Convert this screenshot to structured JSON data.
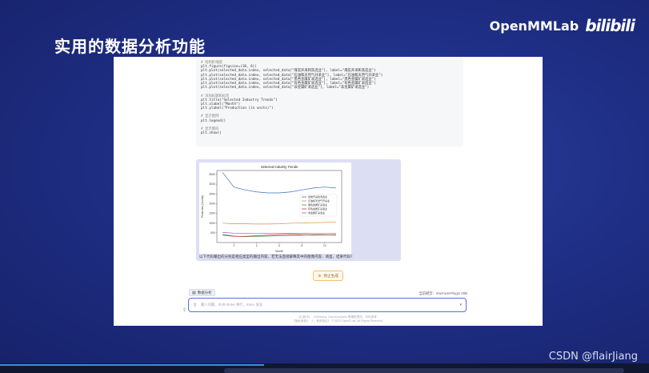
{
  "slide": {
    "title": "实用的数据分析功能",
    "brand": "OpenMMLab",
    "brand_logo_text": "bilibili",
    "watermark": "CSDN @flairJiang"
  },
  "code": {
    "lines": [
      {
        "kind": "comment",
        "text": "# 绘制折线图"
      },
      {
        "kind": "code",
        "text": "plt.figure(figsize=(10, 6))"
      },
      {
        "kind": "code",
        "text": "plt.plot(selected_data.index, selected_data[\"煤炭开采和洗选业\"], label=\"煤炭开采和洗选业\")"
      },
      {
        "kind": "code",
        "text": "plt.plot(selected_data.index, selected_data[\"石油和天然气开采业\"], label=\"石油和天然气开采业\")"
      },
      {
        "kind": "code",
        "text": "plt.plot(selected_data.index, selected_data[\"黑色金属矿采选业\"], label=\"黑色金属矿采选业\")"
      },
      {
        "kind": "code",
        "text": "plt.plot(selected_data.index, selected_data[\"有色金属矿采选业\"], label=\"有色金属矿采选业\")"
      },
      {
        "kind": "code",
        "text": "plt.plot(selected_data.index, selected_data[\"非金属矿采选业\"], label=\"非金属矿采选业\")"
      },
      {
        "kind": "gap",
        "text": ""
      },
      {
        "kind": "comment",
        "text": "# 添加标题和标签"
      },
      {
        "kind": "code",
        "text": "plt.title(\"Selected Industry Trends\")"
      },
      {
        "kind": "code",
        "text": "plt.xlabel(\"Month\")"
      },
      {
        "kind": "code",
        "text": "plt.ylabel(\"Production (in units)\")"
      },
      {
        "kind": "gap",
        "text": ""
      },
      {
        "kind": "comment",
        "text": "# 显示图例"
      },
      {
        "kind": "code",
        "text": "plt.legend()"
      },
      {
        "kind": "gap",
        "text": ""
      },
      {
        "kind": "comment",
        "text": "# 显示图形"
      },
      {
        "kind": "code",
        "text": "plt.show()"
      }
    ]
  },
  "result": {
    "caption": "以下代码输出的分别是相应类型的输出内容，若无法直接解释其中的图像内容，请直，结果代码?"
  },
  "stop_button": {
    "label": "停止生成",
    "icon": "stop-icon"
  },
  "toolbar": {
    "tag_label": "数据分析",
    "tag_icon": "chart-icon",
    "model_label": "当前模型：InternLM-Plugin 20B"
  },
  "input": {
    "placeholder": "输入问题，Shift+Enter 换行，Enter 发送",
    "upload_icon": "upload-icon",
    "send_icon": "chevron-down-icon"
  },
  "footer": {
    "line1": "由 [新手] ... LMDeploy, OpenCompass 等模型提供，仅供参考",
    "line2": "《隐私条款》 《... 使用协议》 © 2023 OpenCLab. All Rights Reserved."
  },
  "chart_data": {
    "type": "line",
    "title": "Selected Industry Trends",
    "xlabel": "Month",
    "ylabel": "Production (in units)",
    "x": [
      1,
      2,
      3,
      4,
      5,
      6,
      7,
      8,
      9,
      10,
      11
    ],
    "xlim": [
      0.5,
      11.5
    ],
    "ylim": [
      0,
      3700
    ],
    "yticks": [
      500,
      1000,
      1500,
      2000,
      2500,
      3000,
      3500
    ],
    "xticks": [
      0,
      2,
      4,
      6,
      8,
      10
    ],
    "grid": false,
    "legend_position": "center-right",
    "series": [
      {
        "name": "煤炭开采和洗选业",
        "color": "#3a6fc4",
        "values": [
          3600,
          2850,
          2700,
          2600,
          2550,
          2550,
          2600,
          2700,
          2800,
          2850,
          2800
        ]
      },
      {
        "name": "石油和天然气开采业",
        "color": "#e08a3a",
        "values": [
          1000,
          960,
          960,
          950,
          950,
          960,
          990,
          1010,
          1020,
          1030,
          1050
        ]
      },
      {
        "name": "黑色金属矿采选业",
        "color": "#3b9a4a",
        "values": [
          420,
          330,
          300,
          320,
          330,
          350,
          360,
          380,
          400,
          400,
          380
        ]
      },
      {
        "name": "有色金属矿采选业",
        "color": "#c53b3b",
        "values": [
          380,
          320,
          320,
          350,
          380,
          410,
          420,
          400,
          380,
          390,
          400
        ]
      },
      {
        "name": "非金属矿采选业",
        "color": "#8a5ac0",
        "values": [
          520,
          480,
          470,
          460,
          470,
          480,
          480,
          470,
          460,
          460,
          470
        ]
      }
    ]
  }
}
